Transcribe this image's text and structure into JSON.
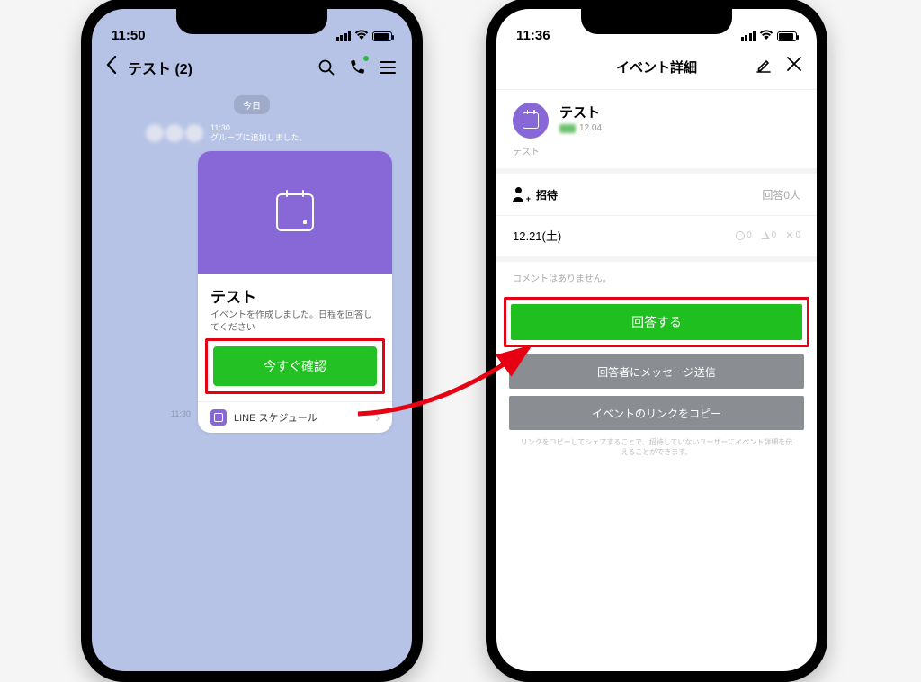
{
  "left": {
    "status_time": "11:50",
    "header": {
      "back": "‹",
      "title": "テスト (2)"
    },
    "date_chip": "今日",
    "sys": {
      "time": "11:30",
      "text": "グループに追加しました。"
    },
    "card": {
      "title": "テスト",
      "subtitle": "イベントを作成しました。日程を回答してください",
      "button": "今すぐ確認",
      "footer": "LINE スケジュール"
    },
    "timestamp": "11:30"
  },
  "right": {
    "status_time": "11:36",
    "header_title": "イベント詳細",
    "event": {
      "title": "テスト",
      "date": "12.04",
      "desc": "テスト"
    },
    "invite": {
      "label": "招待",
      "count": "回答0人"
    },
    "date_option": {
      "date": "12.21(土)",
      "yes": "0",
      "maybe": "0",
      "no": "0"
    },
    "comment_empty": "コメントはありません。",
    "buttons": {
      "answer": "回答する",
      "message": "回答者にメッセージ送信",
      "copylink": "イベントのリンクをコピー"
    },
    "note": "リンクをコピーしてシェアすることで、招待していないユーザーにイベント詳細を伝えることができます。"
  }
}
